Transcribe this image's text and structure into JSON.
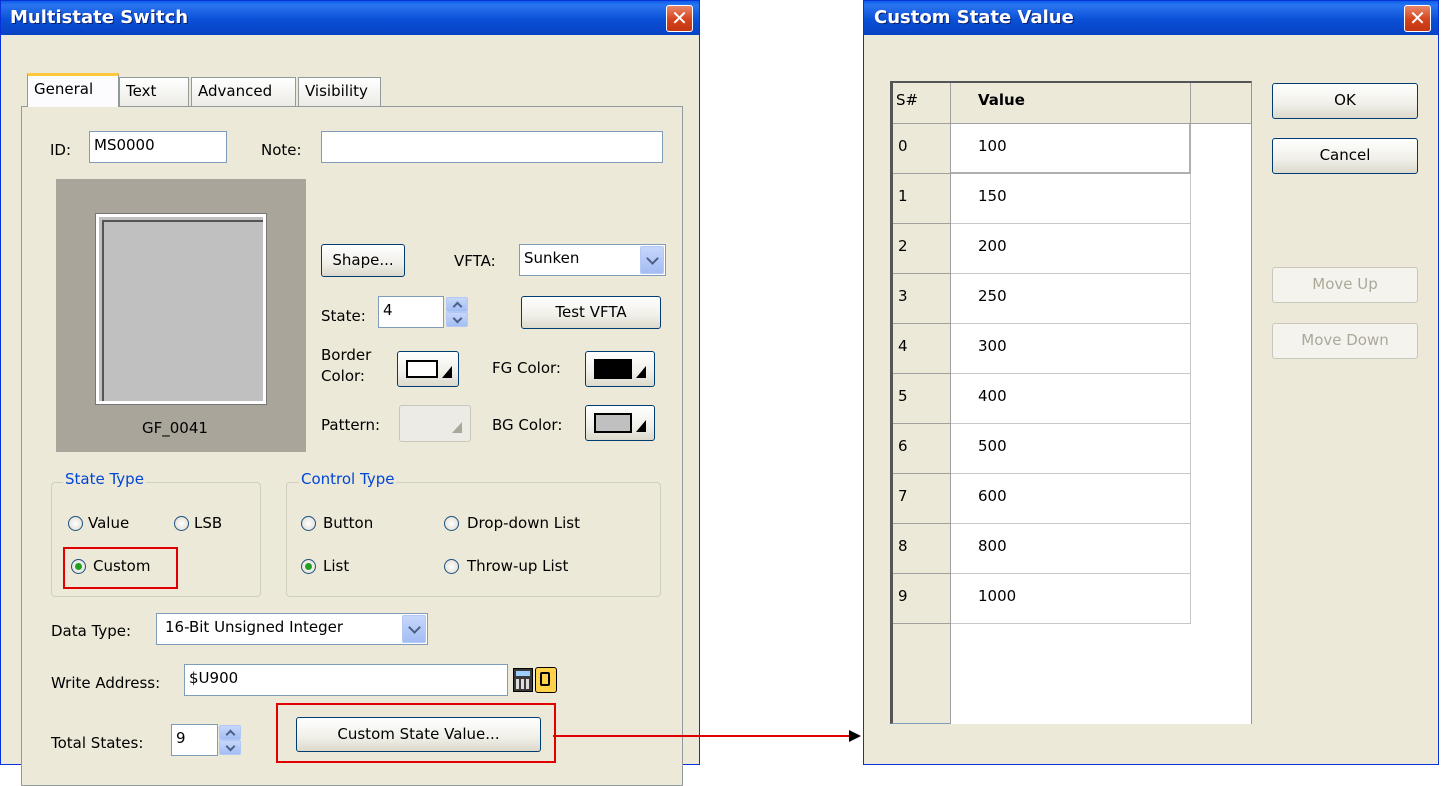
{
  "left_window": {
    "title": "Multistate Switch",
    "tabs": [
      "General",
      "Text",
      "Advanced",
      "Visibility"
    ],
    "active_tab": "General",
    "id_label": "ID:",
    "id_value": "MS0000",
    "note_label": "Note:",
    "note_value": "",
    "preview_caption": "GF_0041",
    "shape_button": "Shape...",
    "vfta_label": "VFTA:",
    "vfta_value": "Sunken",
    "state_label": "State:",
    "state_value": "4",
    "test_vfta_button": "Test VFTA",
    "border_color_label_1": "Border",
    "border_color_label_2": "Color:",
    "fg_color_label": "FG Color:",
    "pattern_label": "Pattern:",
    "bg_color_label": "BG Color:",
    "state_type": {
      "legend": "State Type",
      "options": [
        "Value",
        "LSB",
        "Custom"
      ],
      "selected": "Custom"
    },
    "control_type": {
      "legend": "Control Type",
      "options": [
        "Button",
        "Drop-down List",
        "List",
        "Throw-up List"
      ],
      "selected": "List"
    },
    "data_type_label": "Data Type:",
    "data_type_value": "16-Bit Unsigned Integer",
    "write_address_label": "Write Address:",
    "write_address_value": "$U900",
    "total_states_label": "Total States:",
    "total_states_value": "9",
    "custom_state_button": "Custom State Value..."
  },
  "right_window": {
    "title": "Custom State Value",
    "columns": [
      "S#",
      "Value"
    ],
    "rows": [
      {
        "s": "0",
        "value": "100"
      },
      {
        "s": "1",
        "value": "150"
      },
      {
        "s": "2",
        "value": "200"
      },
      {
        "s": "3",
        "value": "250"
      },
      {
        "s": "4",
        "value": "300"
      },
      {
        "s": "5",
        "value": "400"
      },
      {
        "s": "6",
        "value": "500"
      },
      {
        "s": "7",
        "value": "600"
      },
      {
        "s": "8",
        "value": "800"
      },
      {
        "s": "9",
        "value": "1000"
      }
    ],
    "ok_button": "OK",
    "cancel_button": "Cancel",
    "move_up_button": "Move Up",
    "move_down_button": "Move Down"
  },
  "colors": {
    "titlebar": "#0a50d6",
    "highlight_red": "#e00000",
    "dialog_bg": "#ece9d8"
  },
  "icons": [
    "close-icon",
    "spinner-icon",
    "chevron-down-icon",
    "calculator-icon",
    "tag-icon",
    "arrow-right-icon"
  ]
}
